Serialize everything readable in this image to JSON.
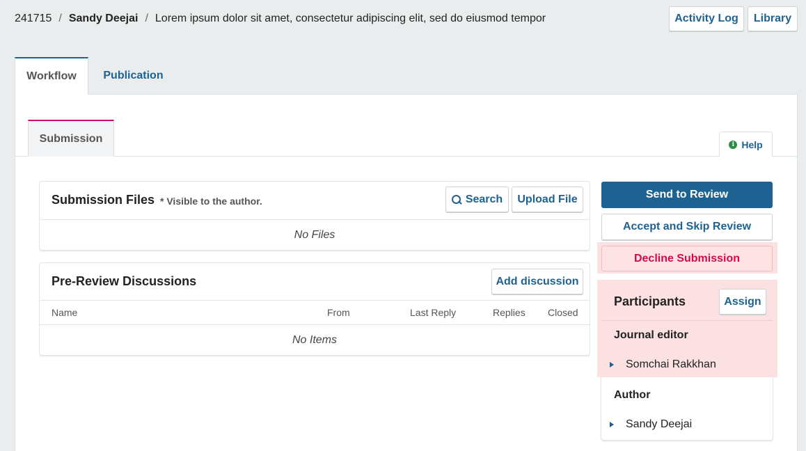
{
  "header": {
    "submission_id": "241715",
    "separator": "/",
    "author": "Sandy Deejai",
    "title": "Lorem ipsum dolor sit amet, consectetur adipiscing elit, sed do eiusmod tempor",
    "activity_log_label": "Activity Log",
    "library_label": "Library"
  },
  "main_tabs": [
    {
      "label": "Workflow",
      "active": true
    },
    {
      "label": "Publication",
      "active": false
    }
  ],
  "stage_tab": {
    "label": "Submission"
  },
  "help": {
    "label": "Help",
    "icon": "info-icon"
  },
  "submission_files": {
    "title": "Submission Files",
    "note": "* Visible to the author.",
    "search_label": "Search",
    "upload_label": "Upload File",
    "empty": "No Files"
  },
  "discussions": {
    "title": "Pre-Review Discussions",
    "add_label": "Add discussion",
    "columns": [
      "Name",
      "From",
      "Last Reply",
      "Replies",
      "Closed"
    ],
    "empty": "No Items"
  },
  "actions": {
    "send_to_review": "Send to Review",
    "accept_skip": "Accept and Skip Review",
    "decline": "Decline Submission"
  },
  "participants": {
    "title": "Participants",
    "assign_label": "Assign",
    "groups": [
      {
        "role": "Journal editor",
        "people": [
          "Somchai Rakkhan"
        ]
      },
      {
        "role": "Author",
        "people": [
          "Sandy Deejai"
        ]
      }
    ]
  },
  "colors": {
    "accent": "#1e6292",
    "decline": "#d00a4c",
    "highlight": "#fbe1e1",
    "stage_tab_border": "#d00a6c"
  }
}
